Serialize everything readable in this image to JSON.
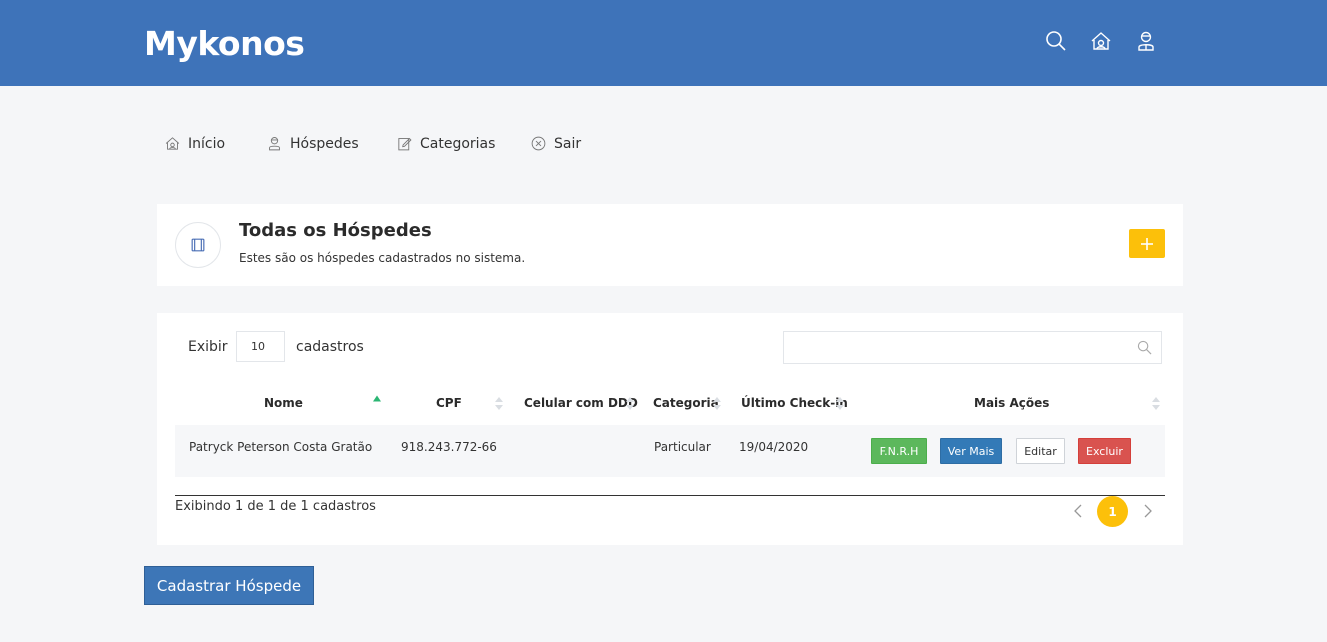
{
  "brand": "Mykonos",
  "topbar": {
    "icons": [
      "search-icon",
      "home-icon",
      "user-icon"
    ]
  },
  "nav": {
    "items": [
      {
        "label": "Início",
        "icon": "home-icon"
      },
      {
        "label": "Hóspedes",
        "icon": "guest-icon"
      },
      {
        "label": "Categorias",
        "icon": "edit-icon"
      },
      {
        "label": "Sair",
        "icon": "close-circle-icon"
      }
    ]
  },
  "header": {
    "title": "Todas os Hóspedes",
    "subtitle": "Estes são os hóspedes cadastrados no sistema.",
    "add_icon": "plus-icon"
  },
  "table": {
    "length_prefix": "Exibir",
    "length_value": "10",
    "length_suffix": "cadastros",
    "search_value": "",
    "columns": [
      "Nome",
      "CPF",
      "Celular com DDD",
      "Categoria",
      "Último Check-in",
      "Mais Ações"
    ],
    "rows": [
      {
        "nome": "Patryck Peterson Costa Gratão",
        "cpf": "918.243.772-66",
        "celular": "",
        "categoria": "Particular",
        "checkin": "19/04/2020",
        "actions": [
          "F.N.R.H",
          "Ver Mais",
          "Editar",
          "Excluir"
        ]
      }
    ],
    "info": "Exibindo 1 de 1 de 1 cadastros",
    "current_page": "1"
  },
  "cta_label": "Cadastrar Hóspede",
  "colors": {
    "topbar": "#3e73b9",
    "accent": "#fcc00a",
    "success": "#5cb85c",
    "primary": "#337ab7",
    "danger": "#d9534f",
    "sort_active": "#2bb673"
  }
}
